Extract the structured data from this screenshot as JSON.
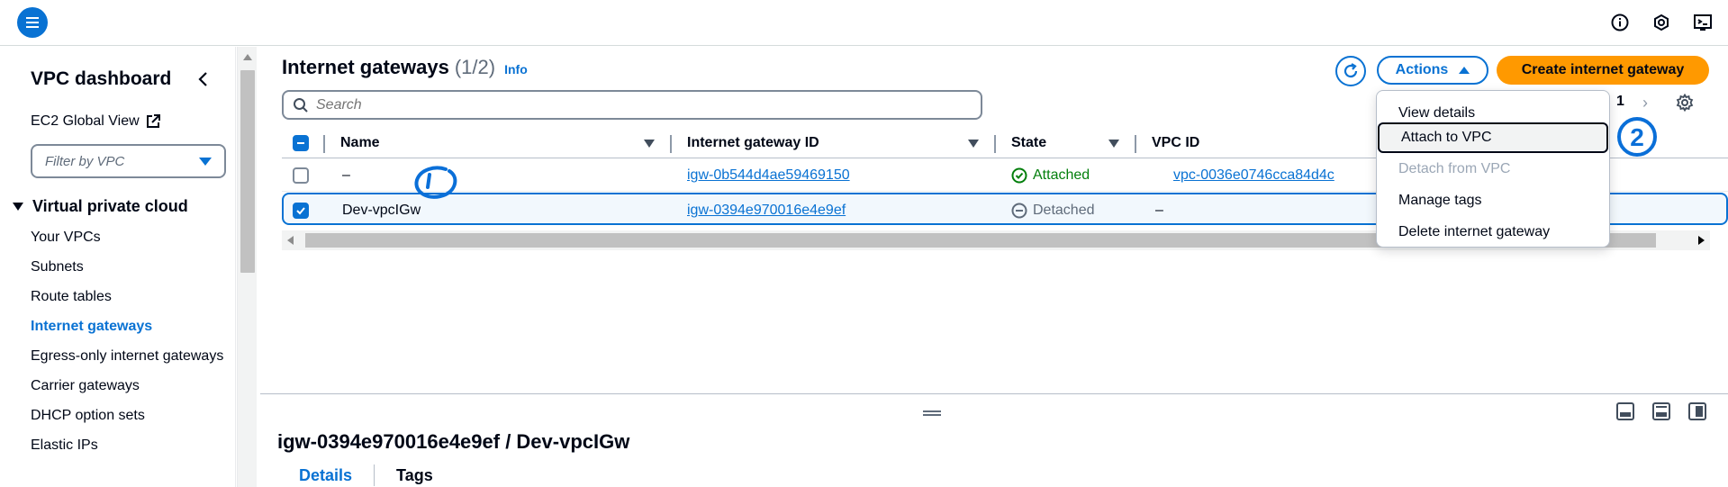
{
  "sidebar": {
    "title": "VPC dashboard",
    "ec2_global_view": "EC2 Global View",
    "filter_placeholder": "Filter by VPC",
    "section": "Virtual private cloud",
    "items": [
      {
        "label": "Your VPCs"
      },
      {
        "label": "Subnets"
      },
      {
        "label": "Route tables"
      },
      {
        "label": "Internet gateways"
      },
      {
        "label": "Egress-only internet gateways"
      },
      {
        "label": "Carrier gateways"
      },
      {
        "label": "DHCP option sets"
      },
      {
        "label": "Elastic IPs"
      }
    ],
    "active_item": "Internet gateways"
  },
  "header": {
    "title": "Internet gateways",
    "count": "(1/2)",
    "info": "Info",
    "actions_label": "Actions",
    "create_label": "Create internet gateway",
    "search_placeholder": "Search",
    "page_number": "1"
  },
  "table": {
    "columns": [
      "Name",
      "Internet gateway ID",
      "State",
      "VPC ID"
    ],
    "rows": [
      {
        "name": "–",
        "igw_id": "igw-0b544d4ae59469150",
        "state": "Attached",
        "vpc_id": "vpc-0036e0746cca84d4c",
        "selected": false
      },
      {
        "name": "Dev-vpcIGw",
        "igw_id": "igw-0394e970016e4e9ef",
        "state": "Detached",
        "vpc_id": "–",
        "selected": true
      }
    ]
  },
  "actions_menu": {
    "items": [
      {
        "label": "View details",
        "state": "enabled"
      },
      {
        "label": "Attach to VPC",
        "state": "hovered"
      },
      {
        "label": "Detach from VPC",
        "state": "disabled"
      },
      {
        "label": "Manage tags",
        "state": "enabled"
      },
      {
        "label": "Delete internet gateway",
        "state": "enabled"
      }
    ]
  },
  "detail_panel": {
    "title": "igw-0394e970016e4e9ef / Dev-vpcIGw",
    "tabs": [
      "Details",
      "Tags"
    ],
    "active_tab": "Details"
  },
  "annotations": {
    "marker_2": "2"
  },
  "colors": {
    "primary": "#0972d3",
    "create_button": "#ff9900",
    "attached": "#037f0c",
    "detached": "#5f6b7a"
  },
  "icons": {
    "menu": "hamburger-icon",
    "info": "info-icon",
    "notifications": "bell-icon",
    "settings": "gear-icon",
    "refresh": "refresh-icon"
  }
}
